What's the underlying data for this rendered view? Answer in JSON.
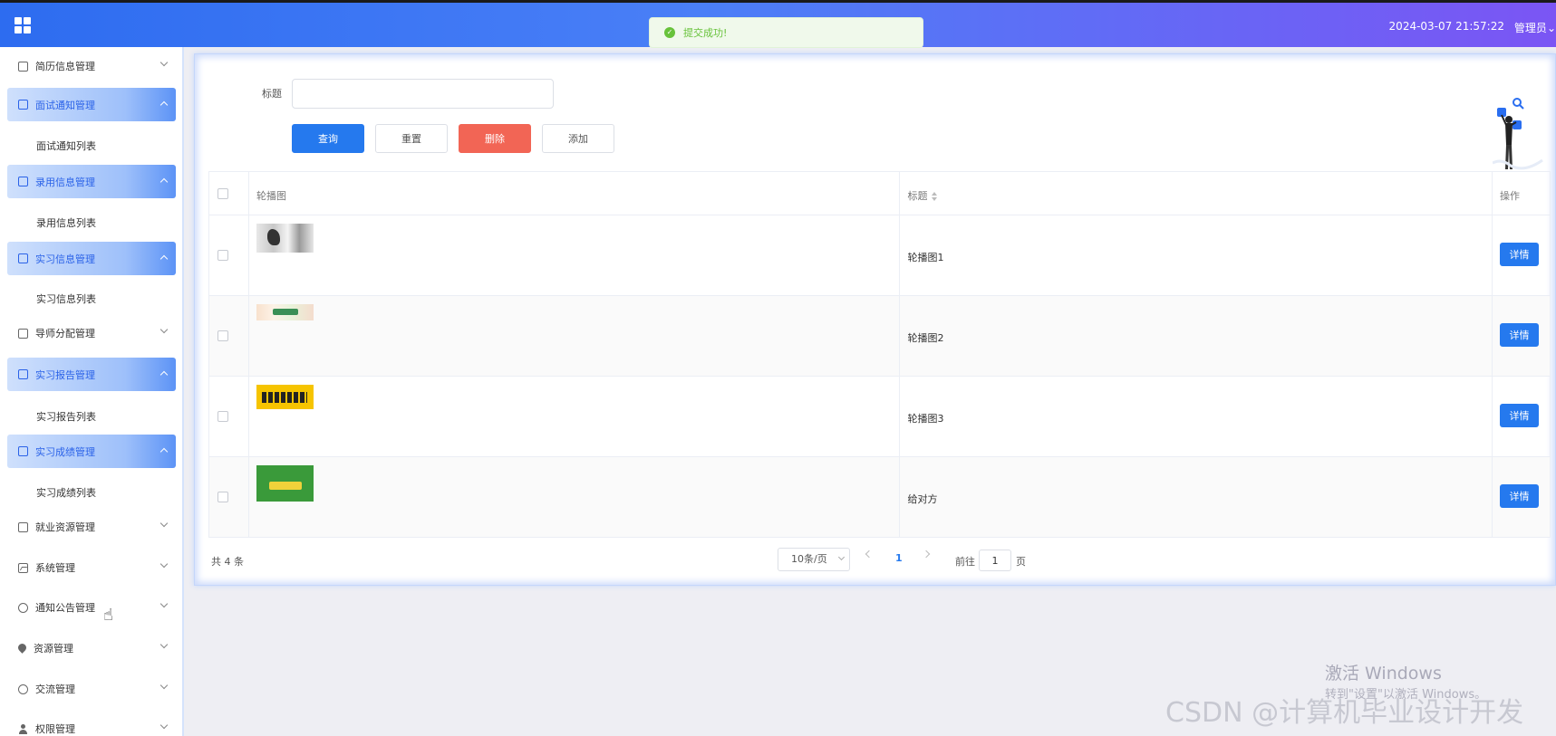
{
  "header": {
    "datetime": "2024-03-07 21:57:22",
    "user": "管理员",
    "user_arrow": "⌄"
  },
  "toast": {
    "icon": "✓",
    "message": "提交成功!"
  },
  "sidebar": {
    "items": [
      {
        "label": "简历信息管理",
        "icon": "doc-icon",
        "active": false
      },
      {
        "label": "面试通知管理",
        "icon": "doc-icon",
        "active": true,
        "sub": "面试通知列表"
      },
      {
        "label": "录用信息管理",
        "icon": "doc-icon",
        "active": true,
        "sub": "录用信息列表"
      },
      {
        "label": "实习信息管理",
        "icon": "doc-icon",
        "active": true,
        "sub": "实习信息列表"
      },
      {
        "label": "导师分配管理",
        "icon": "doc-icon",
        "active": false
      },
      {
        "label": "实习报告管理",
        "icon": "doc-icon",
        "active": true,
        "sub": "实习报告列表"
      },
      {
        "label": "实习成绩管理",
        "icon": "doc-icon",
        "active": true,
        "sub": "实习成绩列表"
      },
      {
        "label": "就业资源管理",
        "icon": "doc-icon",
        "active": false
      },
      {
        "label": "系统管理",
        "icon": "image-icon",
        "active": false
      },
      {
        "label": "通知公告管理",
        "icon": "info-icon",
        "active": false
      },
      {
        "label": "资源管理",
        "icon": "pin-icon",
        "active": false
      },
      {
        "label": "交流管理",
        "icon": "chat-icon",
        "active": false
      },
      {
        "label": "权限管理",
        "icon": "user-icon",
        "active": false
      }
    ]
  },
  "search": {
    "title_label": "标题",
    "title_value": "",
    "query_label": "查询",
    "reset_label": "重置",
    "delete_label": "删除",
    "add_label": "添加"
  },
  "table": {
    "columns": [
      "轮播图",
      "标题",
      "操作"
    ],
    "rows": [
      {
        "title": "轮播图1",
        "action": "详情"
      },
      {
        "title": "轮播图2",
        "action": "详情"
      },
      {
        "title": "轮播图3",
        "action": "详情"
      },
      {
        "title": "给对方",
        "action": "详情"
      }
    ]
  },
  "pagination": {
    "total_text": "共 4 条",
    "page_size": "10条/页",
    "current_page": "1",
    "goto_label": "前往",
    "goto_value": "1",
    "goto_suffix": "页"
  },
  "watermark": {
    "windows_title": "激活 Windows",
    "windows_sub": "转到\"设置\"以激活 Windows。",
    "csdn": "CSDN @计算机毕业设计开发"
  },
  "colors": {
    "primary": "#2579ee",
    "danger": "#f26555",
    "success": "#67c23a",
    "header_start": "#2d6cf0",
    "header_end": "#7b55f4"
  }
}
